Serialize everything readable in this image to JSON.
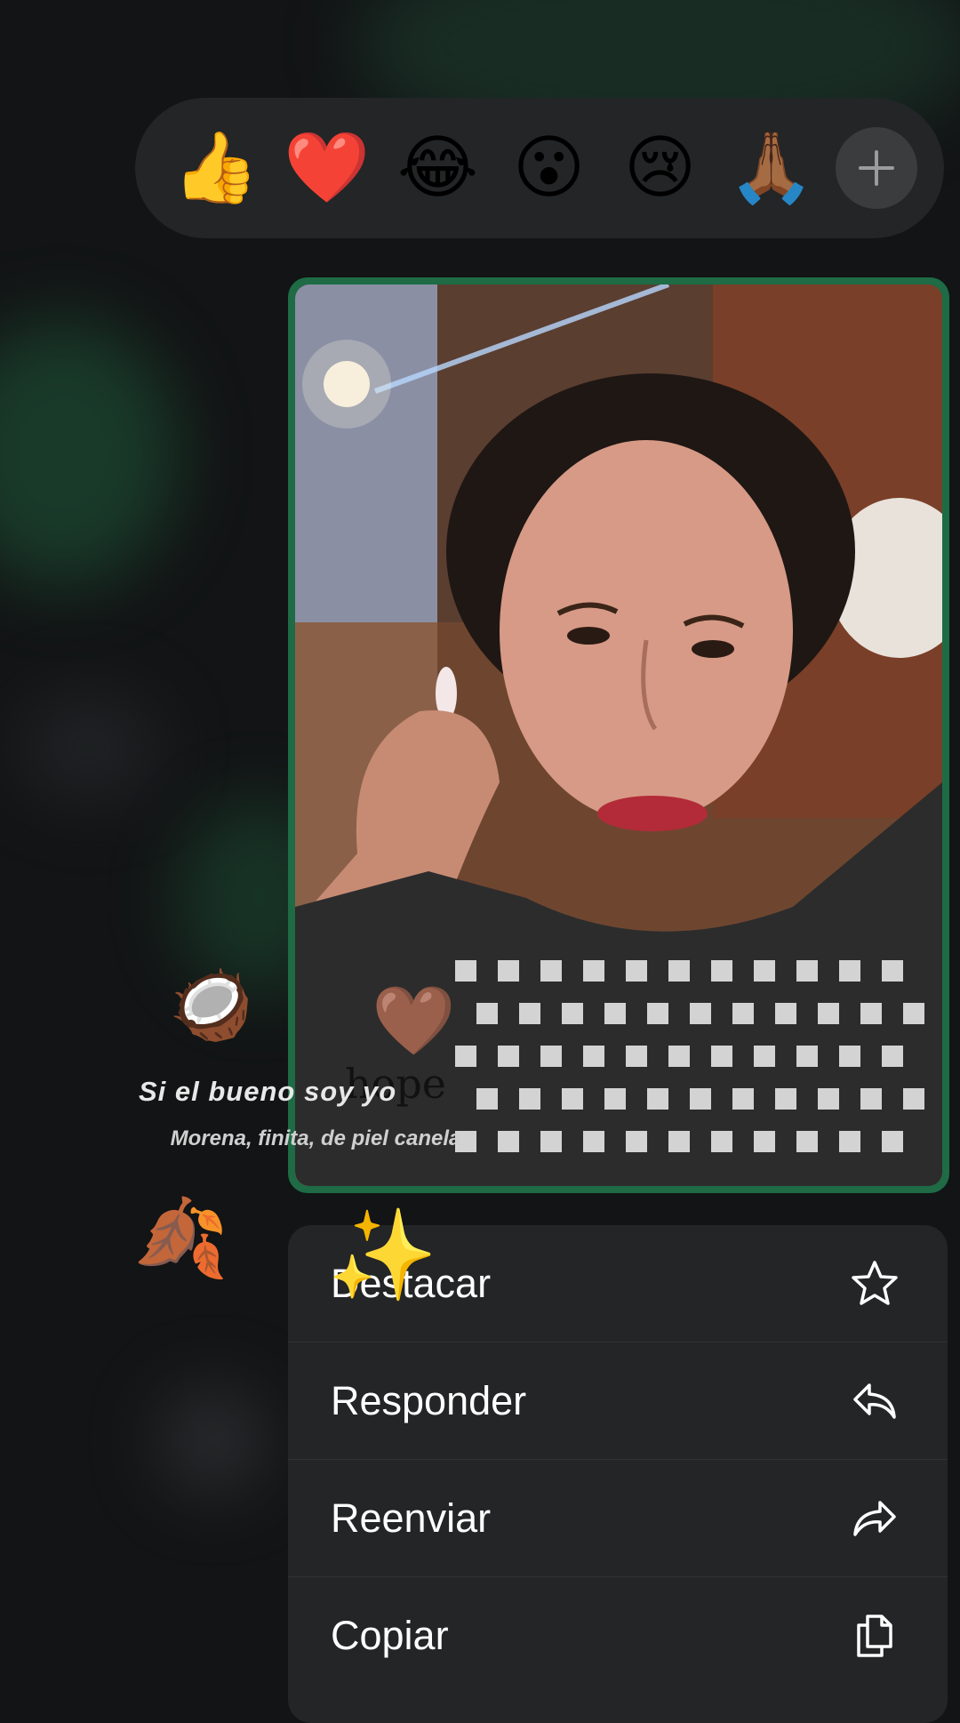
{
  "reactions": {
    "emojis": [
      {
        "glyph": "👍",
        "name": "thumbs-up"
      },
      {
        "glyph": "❤️",
        "name": "red-heart"
      },
      {
        "glyph": "😂",
        "name": "tears-of-joy"
      },
      {
        "glyph": "😮",
        "name": "surprised"
      },
      {
        "glyph": "😢",
        "name": "crying"
      },
      {
        "glyph": "🙏🏾",
        "name": "folded-hands"
      }
    ],
    "more_icon": "plus-icon"
  },
  "stickers": {
    "title": "Si el bueno soy yo",
    "subtitle": "Morena, finita, de piel canela",
    "hope_text": "hope",
    "coconut": "🥥",
    "heart": "🤎",
    "leaves": "🍂",
    "sparkles": "✨"
  },
  "menu": {
    "items": [
      {
        "label": "Destacar",
        "icon": "star-icon"
      },
      {
        "label": "Responder",
        "icon": "reply-icon"
      },
      {
        "label": "Reenviar",
        "icon": "forward-icon"
      },
      {
        "label": "Copiar",
        "icon": "copy-icon"
      }
    ]
  },
  "colors": {
    "bubble": "#1e6b45",
    "menu_bg": "#232526",
    "reaction_bar_bg": "#232526",
    "app_bg": "#121415"
  }
}
